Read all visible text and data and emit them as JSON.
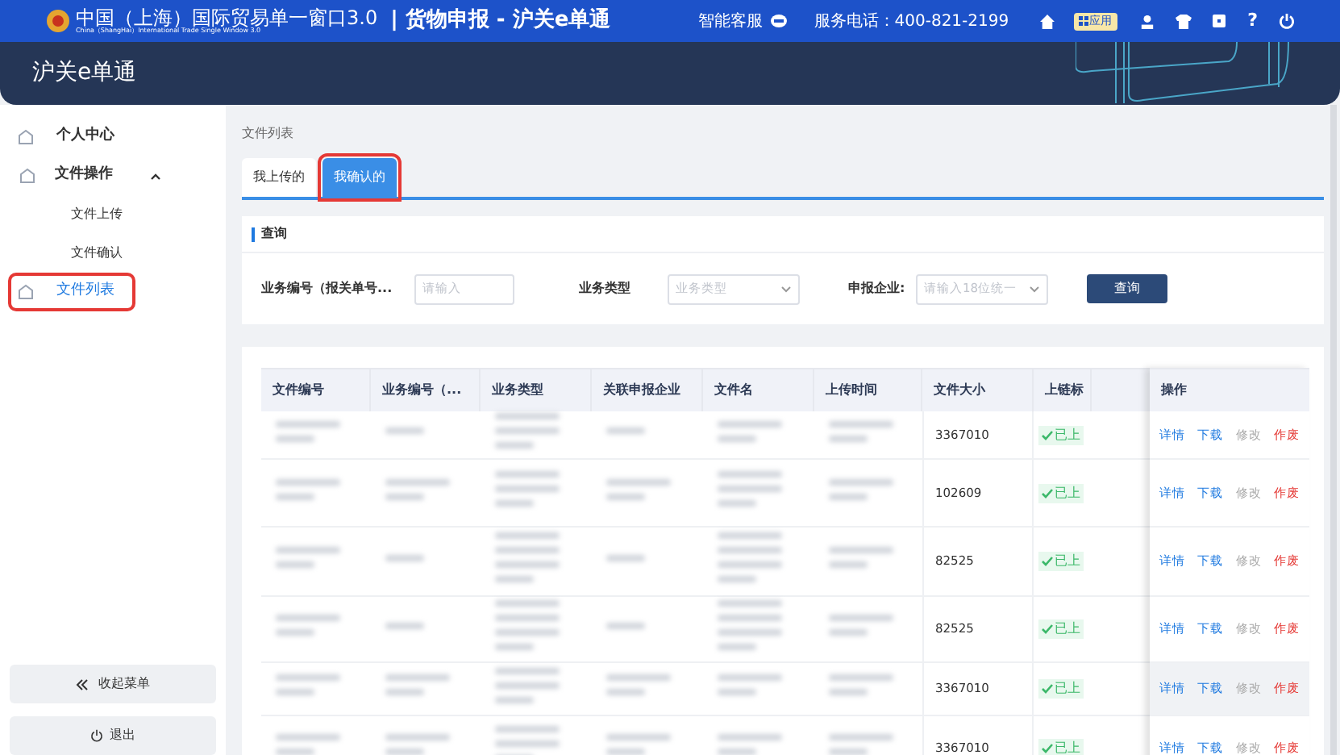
{
  "top_bar": {
    "logo_title": "中国（上海）国际贸易单一窗口3.0",
    "logo_subtitle": "China（ShangHai）International Trade Single Window 3.0",
    "app_title": "| 货物申报 - 沪关e单通",
    "service": "智能客服",
    "phone": "服务电话：400-821-2199",
    "apps_label": "应用",
    "help": "?"
  },
  "header": {
    "title": "沪关e单通"
  },
  "sidebar": {
    "items": [
      {
        "label": "个人中心",
        "kind": "top",
        "selected": false,
        "highlighted": false
      },
      {
        "label": "文件操作",
        "kind": "group",
        "expanded": true,
        "selected": false,
        "highlighted": false,
        "children": [
          {
            "label": "文件上传",
            "selected": false,
            "highlighted": false
          },
          {
            "label": "文件确认",
            "selected": false,
            "highlighted": false
          }
        ]
      },
      {
        "label": "文件列表",
        "kind": "top",
        "selected": true,
        "highlighted": true
      }
    ],
    "collapse": "收起菜单",
    "logout": "退出"
  },
  "breadcrumb": "文件列表",
  "tabs": [
    {
      "label": "我上传的",
      "selected": false,
      "highlighted": false
    },
    {
      "label": "我确认的",
      "selected": true,
      "highlighted": true
    }
  ],
  "query": {
    "title": "查询",
    "fields": [
      {
        "label": "业务编号（报关单号...",
        "placeholder": "请输入",
        "kind": "input"
      },
      {
        "label": "业务类型",
        "placeholder": "业务类型",
        "kind": "select"
      },
      {
        "label": "申报企业:",
        "placeholder": "请输入18位统一",
        "kind": "select"
      }
    ],
    "button": "查询"
  },
  "table": {
    "columns": [
      "文件编号",
      "业务编号（...",
      "业务类型",
      "关联申报企业",
      "文件名",
      "上传时间",
      "文件大小",
      "上链标",
      "操作"
    ],
    "rows": [
      {
        "size": "3367010",
        "status": "已上",
        "hovered": false,
        "actions": [
          "详情",
          "下载",
          "修改",
          "作废"
        ]
      },
      {
        "size": "102609",
        "status": "已上",
        "hovered": false,
        "actions": [
          "详情",
          "下载",
          "修改",
          "作废"
        ]
      },
      {
        "size": "82525",
        "status": "已上",
        "hovered": false,
        "actions": [
          "详情",
          "下载",
          "修改",
          "作废"
        ]
      },
      {
        "size": "82525",
        "status": "已上",
        "hovered": false,
        "actions": [
          "详情",
          "下载",
          "修改",
          "作废"
        ]
      },
      {
        "size": "3367010",
        "status": "已上",
        "hovered": true,
        "actions": [
          "详情",
          "下载",
          "修改",
          "作废"
        ]
      },
      {
        "size": "3367010",
        "status": "已上",
        "hovered": false,
        "actions": [
          "详情",
          "下载",
          "修改",
          "作废"
        ]
      }
    ]
  }
}
